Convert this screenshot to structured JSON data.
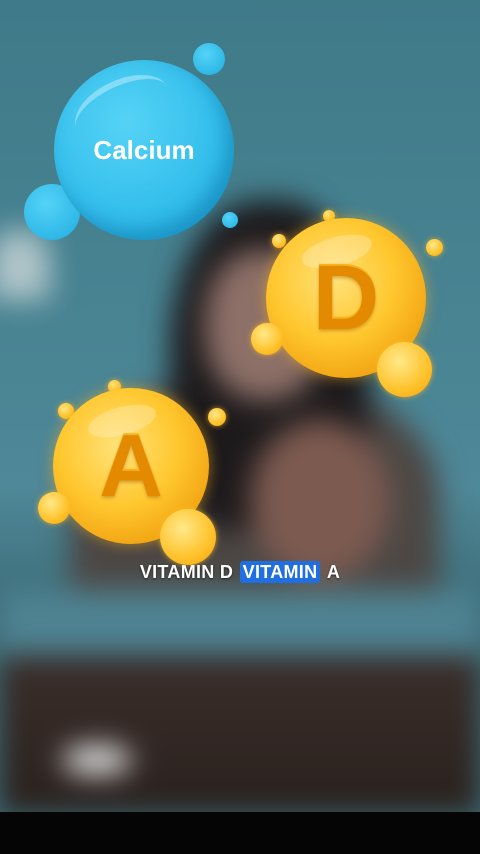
{
  "bubble": {
    "label": "Calcium",
    "color": "#35bfec"
  },
  "vitamins": [
    {
      "letter": "D"
    },
    {
      "letter": "A"
    }
  ],
  "caption": {
    "word1": "VITAMIN D",
    "word2": "VITAMIN",
    "word3": "A",
    "highlight_color": "#1f6fe0"
  }
}
